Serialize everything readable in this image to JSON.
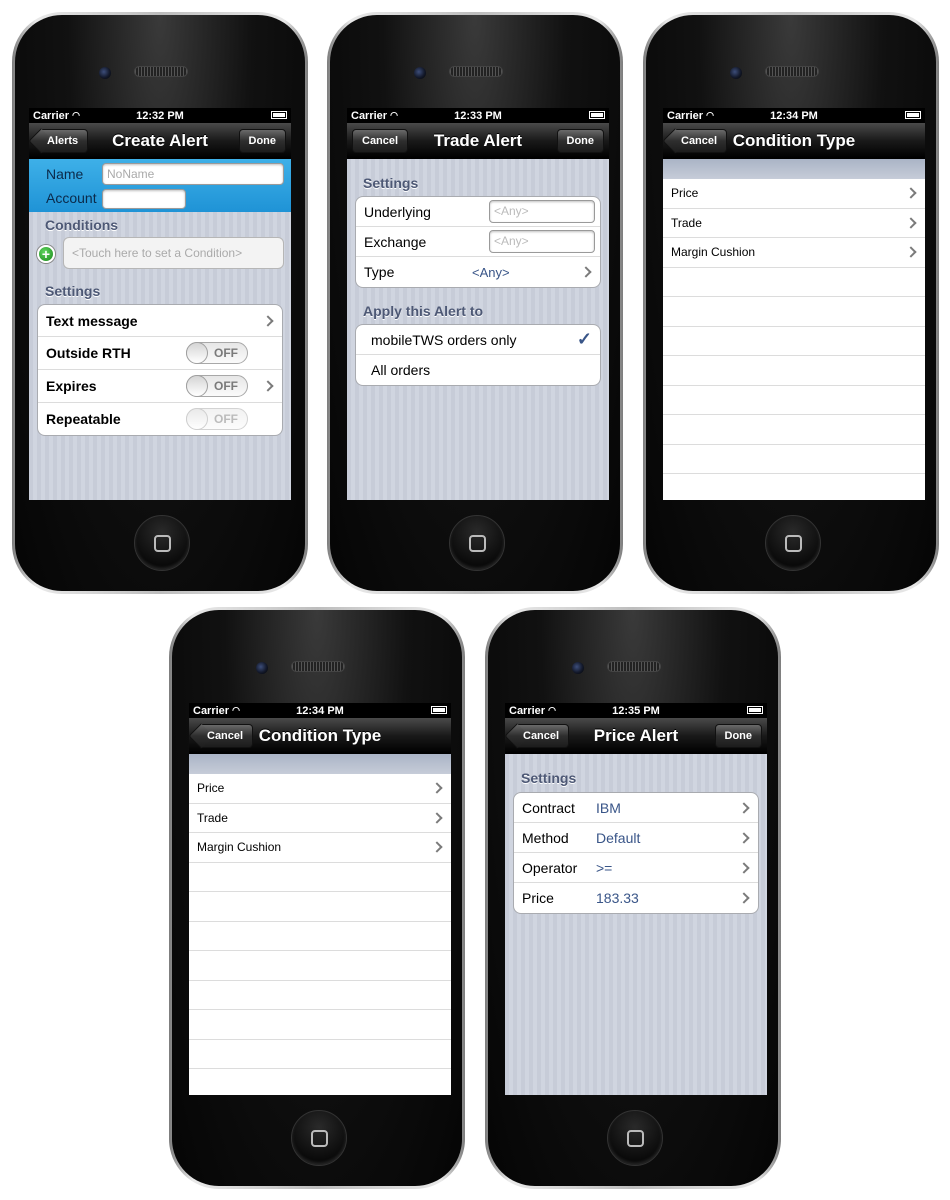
{
  "status": {
    "carrier": "Carrier",
    "times": [
      "12:32 PM",
      "12:33 PM",
      "12:34 PM",
      "12:34 PM",
      "12:35 PM"
    ]
  },
  "create_alert": {
    "back_label": "Alerts",
    "title": "Create Alert",
    "done_label": "Done",
    "name_label": "Name",
    "name_placeholder": "NoName",
    "account_label": "Account",
    "conditions_header": "Conditions",
    "condition_placeholder": "<Touch here to set a Condition>",
    "settings_header": "Settings",
    "rows": [
      {
        "label": "Text message"
      },
      {
        "label": "Outside RTH",
        "switch": "OFF"
      },
      {
        "label": "Expires",
        "switch": "OFF"
      },
      {
        "label": "Repeatable",
        "switch": "OFF"
      }
    ]
  },
  "trade_alert": {
    "cancel_label": "Cancel",
    "title": "Trade Alert",
    "done_label": "Done",
    "settings_header": "Settings",
    "underlying_label": "Underlying",
    "underlying_placeholder": "<Any>",
    "exchange_label": "Exchange",
    "exchange_placeholder": "<Any>",
    "type_label": "Type",
    "type_value": "<Any>",
    "apply_header": "Apply this Alert to",
    "apply_options": [
      "mobileTWS orders only",
      "All orders"
    ]
  },
  "condition_type": {
    "cancel_label": "Cancel",
    "title": "Condition Type",
    "items": [
      "Price",
      "Trade",
      "Margin Cushion"
    ]
  },
  "price_alert": {
    "cancel_label": "Cancel",
    "title": "Price Alert",
    "done_label": "Done",
    "settings_header": "Settings",
    "rows": [
      {
        "label": "Contract",
        "value": "IBM"
      },
      {
        "label": "Method",
        "value": "Default"
      },
      {
        "label": "Operator",
        "value": ">="
      },
      {
        "label": "Price",
        "value": "183.33"
      }
    ]
  }
}
